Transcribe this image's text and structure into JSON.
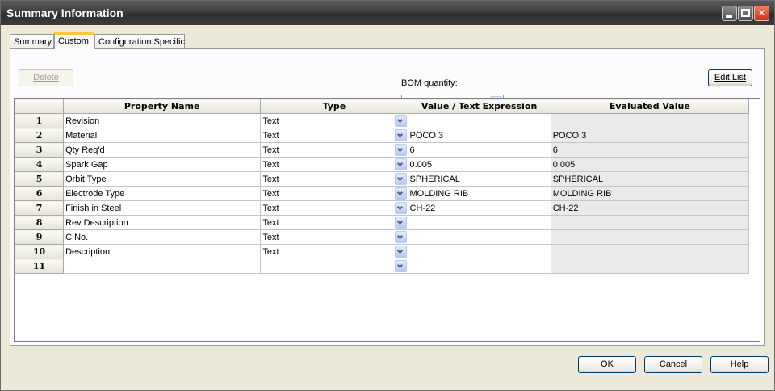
{
  "window": {
    "title": "Summary Information"
  },
  "tabs": [
    {
      "label": "Summary"
    },
    {
      "label": "Custom"
    },
    {
      "label": "Configuration Specific"
    }
  ],
  "toolbar": {
    "delete_label": "Delete",
    "bom_label": "BOM quantity:",
    "bom_value": "",
    "edit_list_label": "Edit List"
  },
  "table": {
    "columns": [
      "Property Name",
      "Type",
      "Value / Text Expression",
      "Evaluated Value"
    ],
    "rows": [
      {
        "num": "1",
        "name": "Revision",
        "type": "Text",
        "value": "",
        "evaluated": ""
      },
      {
        "num": "2",
        "name": "Material",
        "type": "Text",
        "value": "POCO 3",
        "evaluated": "POCO 3"
      },
      {
        "num": "3",
        "name": "Qty Req'd",
        "type": "Text",
        "value": "6",
        "evaluated": "6"
      },
      {
        "num": "4",
        "name": "Spark Gap",
        "type": "Text",
        "value": "0.005",
        "evaluated": "0.005"
      },
      {
        "num": "5",
        "name": "Orbit Type",
        "type": "Text",
        "value": "SPHERICAL",
        "evaluated": "SPHERICAL"
      },
      {
        "num": "6",
        "name": "Electrode Type",
        "type": "Text",
        "value": "MOLDING RIB",
        "evaluated": "MOLDING RIB"
      },
      {
        "num": "7",
        "name": "Finish in Steel",
        "type": "Text",
        "value": "CH-22",
        "evaluated": "CH-22"
      },
      {
        "num": "8",
        "name": "Rev Description",
        "type": "Text",
        "value": "",
        "evaluated": ""
      },
      {
        "num": "9",
        "name": "C No.",
        "type": "Text",
        "value": "",
        "evaluated": ""
      },
      {
        "num": "10",
        "name": "Description",
        "type": "Text",
        "value": "",
        "evaluated": ""
      },
      {
        "num": "11",
        "name": "",
        "type": "",
        "value": "",
        "evaluated": ""
      }
    ]
  },
  "footer": {
    "ok_label": "OK",
    "cancel_label": "Cancel",
    "help_label": "Help"
  }
}
